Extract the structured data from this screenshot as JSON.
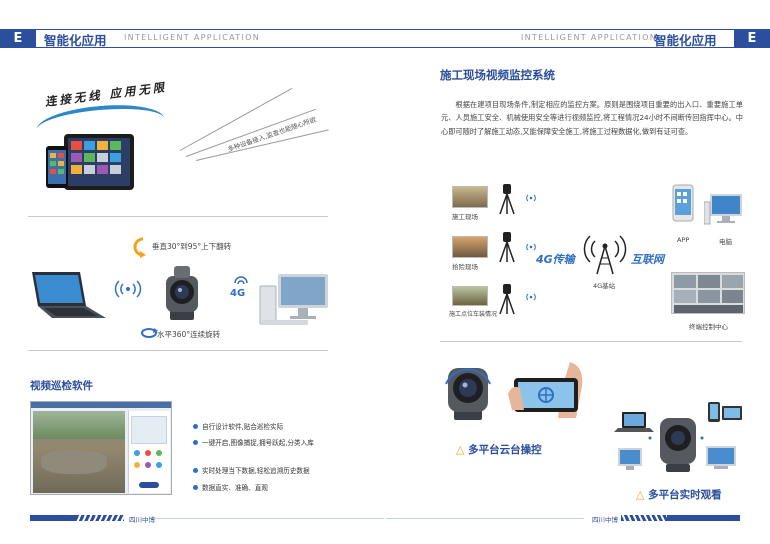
{
  "header": {
    "left_letter": "E",
    "left_title_cn": "智能化应用",
    "left_title_en": "INTELLIGENT APPLICATION",
    "right_title_en": "INTELLIGENT APPLICATION",
    "right_title_cn": "智能化应用",
    "right_letter": "E"
  },
  "left": {
    "slogan": "连接无线 应用无限",
    "diagonal_text": "多种设备接入,监查也能随心所欲",
    "rotation_vertical": "垂直30°到95°上下翻转",
    "rotation_horizontal": "水平360°连续旋转",
    "signal_label": "4G",
    "software_title": "视频巡检软件",
    "bullets": [
      "自行设计软件,贴合巡检实际",
      "一键开启,图像捕捉,拥号跃起,分类入库",
      "实时处理当下数据,轻松追溯历史数据",
      "数据直实、准确、直观"
    ]
  },
  "right": {
    "title": "施工现场视频监控系统",
    "paragraph": "根据在建项目现场条件,制定相应的监控方案。原则是围绕项目重要的出入口、重要施工单元、人员施工安全、机械使用安全等进行视频监控,将工程情况24小时不间断传回指挥中心。中心即可随时了解施工动态,又能保障安全施工,将施工过程数据化,做到有证可查。",
    "sites": [
      "施工现场",
      "拾险现场",
      "施工点位车装情况"
    ],
    "transfer_label": "4G传输",
    "base_label": "4G基站",
    "internet_label": "互联网",
    "app_label": "APP",
    "pc_label": "电脑",
    "center_label": "终端控制中心",
    "ptz_label": "多平台云台操控",
    "view_label": "多平台实时观看"
  },
  "footer": {
    "left_text": "四川中博",
    "right_text": "四川中博"
  },
  "colors": {
    "brand_blue": "#2b4f9c",
    "accent_blue": "#2f6fc2",
    "warning_orange": "#f0a21c"
  }
}
